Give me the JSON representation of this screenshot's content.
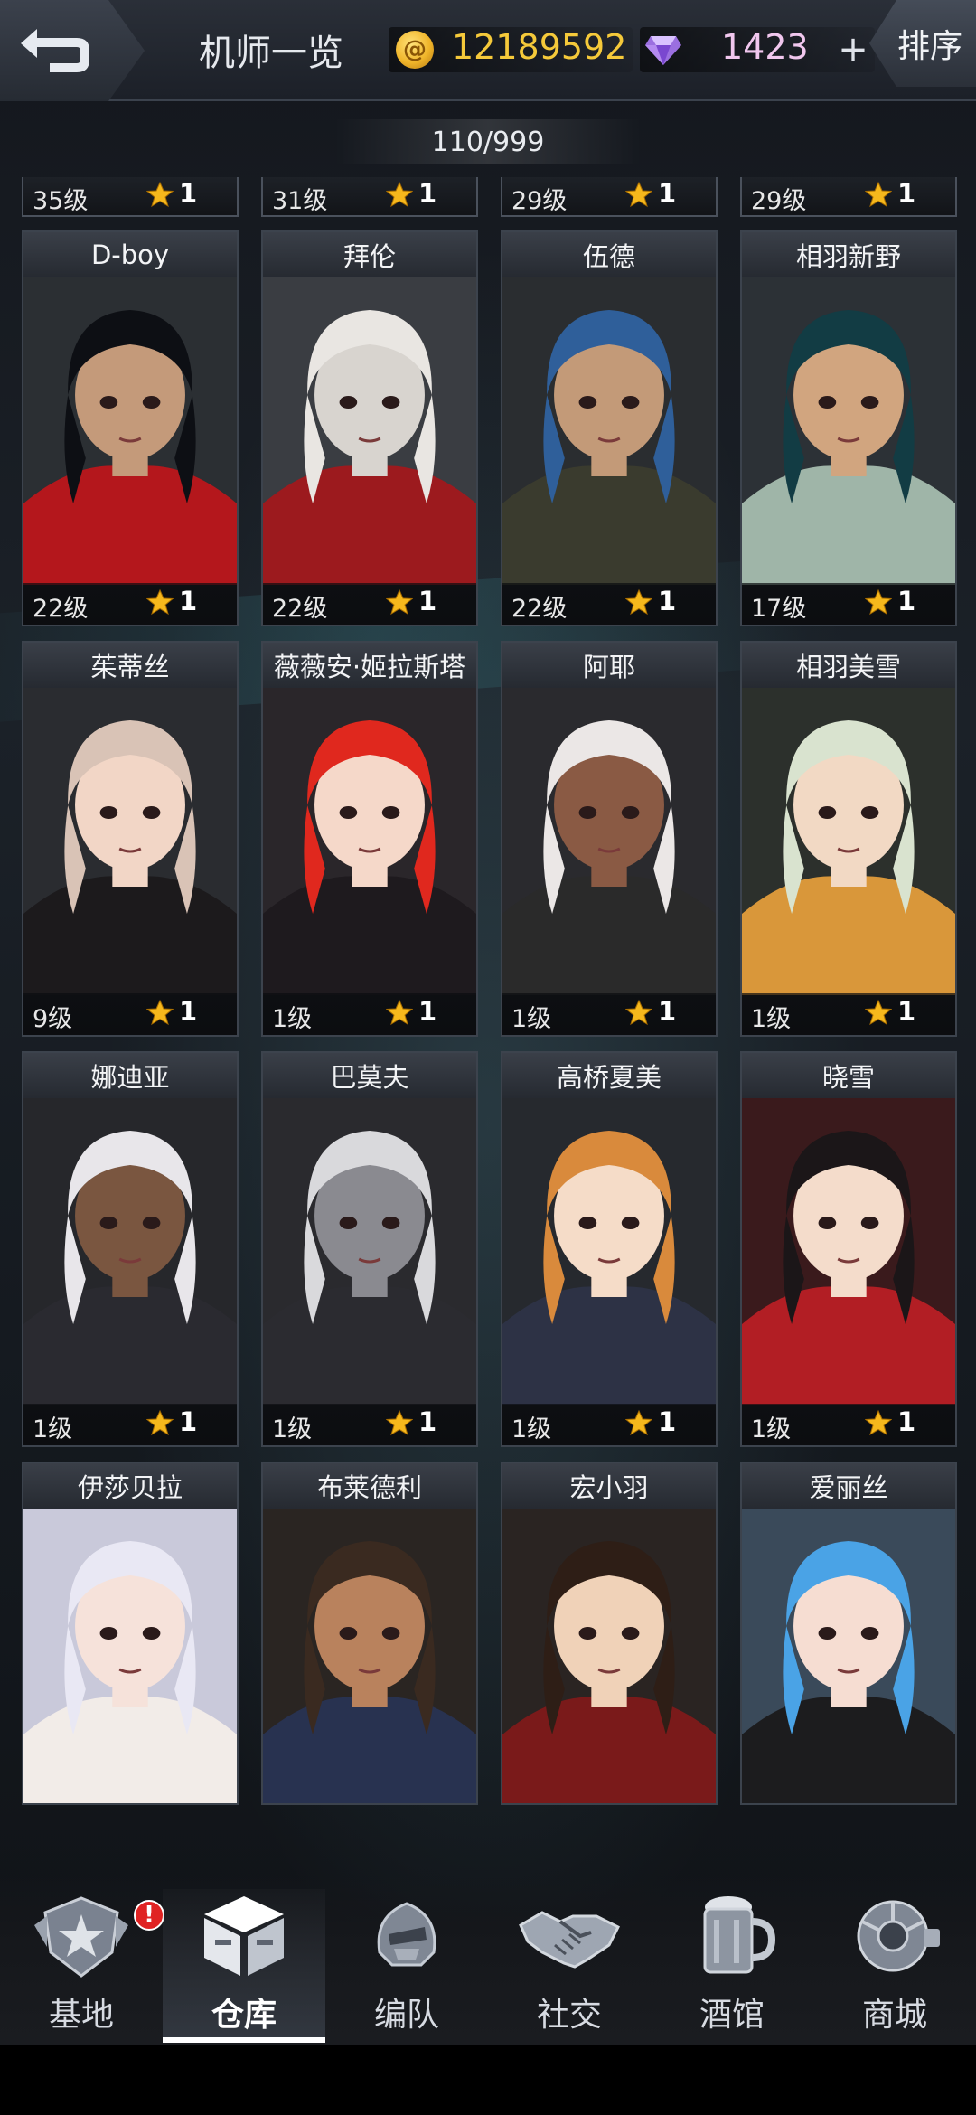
{
  "header": {
    "title": "机师一览",
    "coins": "12189592",
    "gems": "1423",
    "sort_label": "排序",
    "plus_label": "+",
    "count": "110/999",
    "back_icon": "back-arrow-icon",
    "coin_icon": "gold-coin-icon",
    "gem_icon": "diamond-icon"
  },
  "partial_row": [
    {
      "level": "35级",
      "stars": "1"
    },
    {
      "level": "31级",
      "stars": "1"
    },
    {
      "level": "29级",
      "stars": "1"
    },
    {
      "level": "29级",
      "stars": "1"
    }
  ],
  "pilots": [
    {
      "name": "D-boy",
      "level": "22级",
      "stars": "1"
    },
    {
      "name": "拜伦",
      "level": "22级",
      "stars": "1"
    },
    {
      "name": "伍德",
      "level": "22级",
      "stars": "1"
    },
    {
      "name": "相羽新野",
      "level": "17级",
      "stars": "1"
    },
    {
      "name": "茱蒂丝",
      "level": "9级",
      "stars": "1"
    },
    {
      "name": "薇薇安·姬拉斯塔",
      "level": "1级",
      "stars": "1"
    },
    {
      "name": "阿耶",
      "level": "1级",
      "stars": "1"
    },
    {
      "name": "相羽美雪",
      "level": "1级",
      "stars": "1"
    },
    {
      "name": "娜迪亚",
      "level": "1级",
      "stars": "1"
    },
    {
      "name": "巴莫夫",
      "level": "1级",
      "stars": "1"
    },
    {
      "name": "高桥夏美",
      "level": "1级",
      "stars": "1"
    },
    {
      "name": "晓雪",
      "level": "1级",
      "stars": "1"
    },
    {
      "name": "伊莎贝拉",
      "level": "",
      "stars": ""
    },
    {
      "name": "布莱德利",
      "level": "",
      "stars": ""
    },
    {
      "name": "宏小羽",
      "level": "",
      "stars": ""
    },
    {
      "name": "爱丽丝",
      "level": "",
      "stars": ""
    }
  ],
  "nav": {
    "items": [
      {
        "label": "基地",
        "icon": "base-emblem-icon",
        "badge": "!"
      },
      {
        "label": "仓库",
        "icon": "warehouse-cube-icon",
        "active": true
      },
      {
        "label": "编队",
        "icon": "formation-helmet-icon"
      },
      {
        "label": "社交",
        "icon": "handshake-icon"
      },
      {
        "label": "酒馆",
        "icon": "tavern-mug-icon"
      },
      {
        "label": "商城",
        "icon": "shop-orb-icon"
      }
    ]
  },
  "colors": {
    "coin": "#f5c93a",
    "gem": "#f1c7ee",
    "star": "#f6b81c",
    "badge": "#e02323"
  }
}
